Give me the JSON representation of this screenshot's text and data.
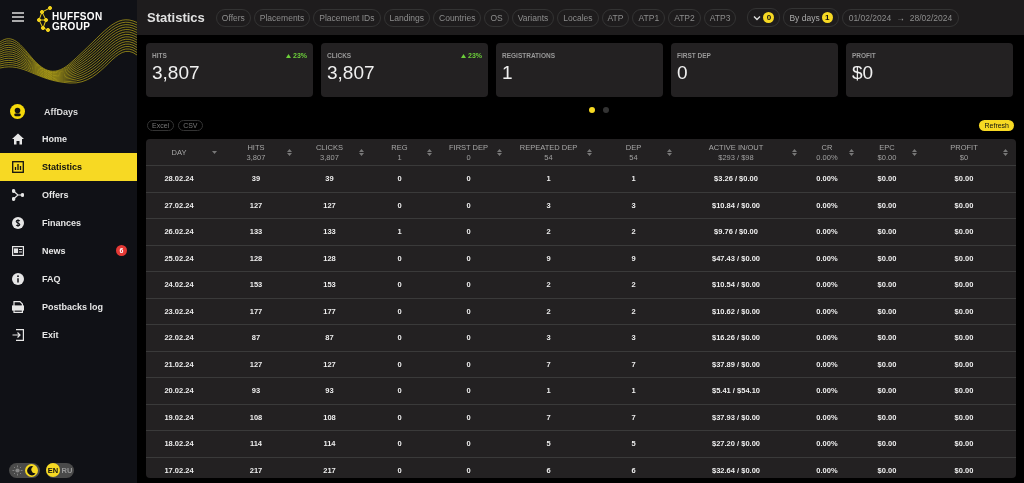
{
  "sidebar": {
    "logo": "HUFFSON GROUP",
    "account": "AffDays",
    "items": [
      {
        "label": "Home",
        "selected": false
      },
      {
        "label": "Statistics",
        "selected": true
      },
      {
        "label": "Offers",
        "selected": false
      },
      {
        "label": "Finances",
        "selected": false
      },
      {
        "label": "News",
        "selected": false,
        "badge": "6"
      },
      {
        "label": "FAQ",
        "selected": false
      },
      {
        "label": "Postbacks log",
        "selected": false
      },
      {
        "label": "Exit",
        "selected": false
      }
    ],
    "theme": {
      "dark": true
    },
    "languages": [
      {
        "label": "EN",
        "selected": true
      },
      {
        "label": "RU",
        "selected": false
      }
    ]
  },
  "header": {
    "title": "Statistics",
    "filters": [
      "Offers",
      "Placements",
      "Placement IDs",
      "Landings",
      "Countries",
      "OS",
      "Variants",
      "Locales",
      "ATP",
      "ATP1",
      "ATP2",
      "ATP3"
    ],
    "dropdown_badge": "0",
    "grouping": {
      "label": "By days",
      "badge": "1"
    },
    "date_range": {
      "from": "01/02/2024",
      "arrow": "→",
      "to": "28/02/2024"
    }
  },
  "cards": [
    {
      "label": "HITS",
      "value": "3,807",
      "delta": "23%",
      "kind": "up"
    },
    {
      "label": "CLICKS",
      "value": "3,807",
      "delta": "23%",
      "kind": "up"
    },
    {
      "label": "REGISTRATIONS",
      "value": "1"
    },
    {
      "label": "FIRST DEP",
      "value": "0"
    },
    {
      "label": "PROFIT",
      "value": "$0"
    }
  ],
  "pager": [
    {
      "selected": true
    },
    {
      "selected": false
    }
  ],
  "exports": [
    "Excel",
    "CSV"
  ],
  "refresh": "Refresh",
  "table": {
    "columns": [
      {
        "label": "DAY",
        "kind": "sorted"
      },
      {
        "label": "HITS",
        "total": "3,807",
        "kind": "sortable"
      },
      {
        "label": "CLICKS",
        "total": "3,807",
        "kind": "sortable"
      },
      {
        "label": "REG",
        "total": "1",
        "kind": "sortable"
      },
      {
        "label": "FIRST DEP",
        "total": "0",
        "kind": "sortable"
      },
      {
        "label": "REPEATED DEP",
        "total": "54",
        "kind": "sortable"
      },
      {
        "label": "DEP",
        "total": "54",
        "kind": "sortable"
      },
      {
        "label": "ACTIVE IN/OUT",
        "total": "$293 / $98",
        "kind": "sortable"
      },
      {
        "label": "CR",
        "total": "0.00%",
        "kind": "sortable"
      },
      {
        "label": "EPC",
        "total": "$0.00",
        "kind": "sortable"
      },
      {
        "label": "PROFIT",
        "total": "$0",
        "kind": "sortable"
      }
    ],
    "rows": [
      [
        "28.02.24",
        "39",
        "39",
        "0",
        "0",
        "1",
        "1",
        "$3.26 / $0.00",
        "0.00%",
        "$0.00",
        "$0.00"
      ],
      [
        "27.02.24",
        "127",
        "127",
        "0",
        "0",
        "3",
        "3",
        "$10.84 / $0.00",
        "0.00%",
        "$0.00",
        "$0.00"
      ],
      [
        "26.02.24",
        "133",
        "133",
        "1",
        "0",
        "2",
        "2",
        "$9.76 / $0.00",
        "0.00%",
        "$0.00",
        "$0.00"
      ],
      [
        "25.02.24",
        "128",
        "128",
        "0",
        "0",
        "9",
        "9",
        "$47.43 / $0.00",
        "0.00%",
        "$0.00",
        "$0.00"
      ],
      [
        "24.02.24",
        "153",
        "153",
        "0",
        "0",
        "2",
        "2",
        "$10.54 / $0.00",
        "0.00%",
        "$0.00",
        "$0.00"
      ],
      [
        "23.02.24",
        "177",
        "177",
        "0",
        "0",
        "2",
        "2",
        "$10.62 / $0.00",
        "0.00%",
        "$0.00",
        "$0.00"
      ],
      [
        "22.02.24",
        "87",
        "87",
        "0",
        "0",
        "3",
        "3",
        "$16.26 / $0.00",
        "0.00%",
        "$0.00",
        "$0.00"
      ],
      [
        "21.02.24",
        "127",
        "127",
        "0",
        "0",
        "7",
        "7",
        "$37.89 / $0.00",
        "0.00%",
        "$0.00",
        "$0.00"
      ],
      [
        "20.02.24",
        "93",
        "93",
        "0",
        "0",
        "1",
        "1",
        "$5.41 / $54.10",
        "0.00%",
        "$0.00",
        "$0.00"
      ],
      [
        "19.02.24",
        "108",
        "108",
        "0",
        "0",
        "7",
        "7",
        "$37.93 / $0.00",
        "0.00%",
        "$0.00",
        "$0.00"
      ],
      [
        "18.02.24",
        "114",
        "114",
        "0",
        "0",
        "5",
        "5",
        "$27.20 / $0.00",
        "0.00%",
        "$0.00",
        "$0.00"
      ],
      [
        "17.02.24",
        "217",
        "217",
        "0",
        "0",
        "6",
        "6",
        "$32.64 / $0.00",
        "0.00%",
        "$0.00",
        "$0.00"
      ]
    ]
  }
}
